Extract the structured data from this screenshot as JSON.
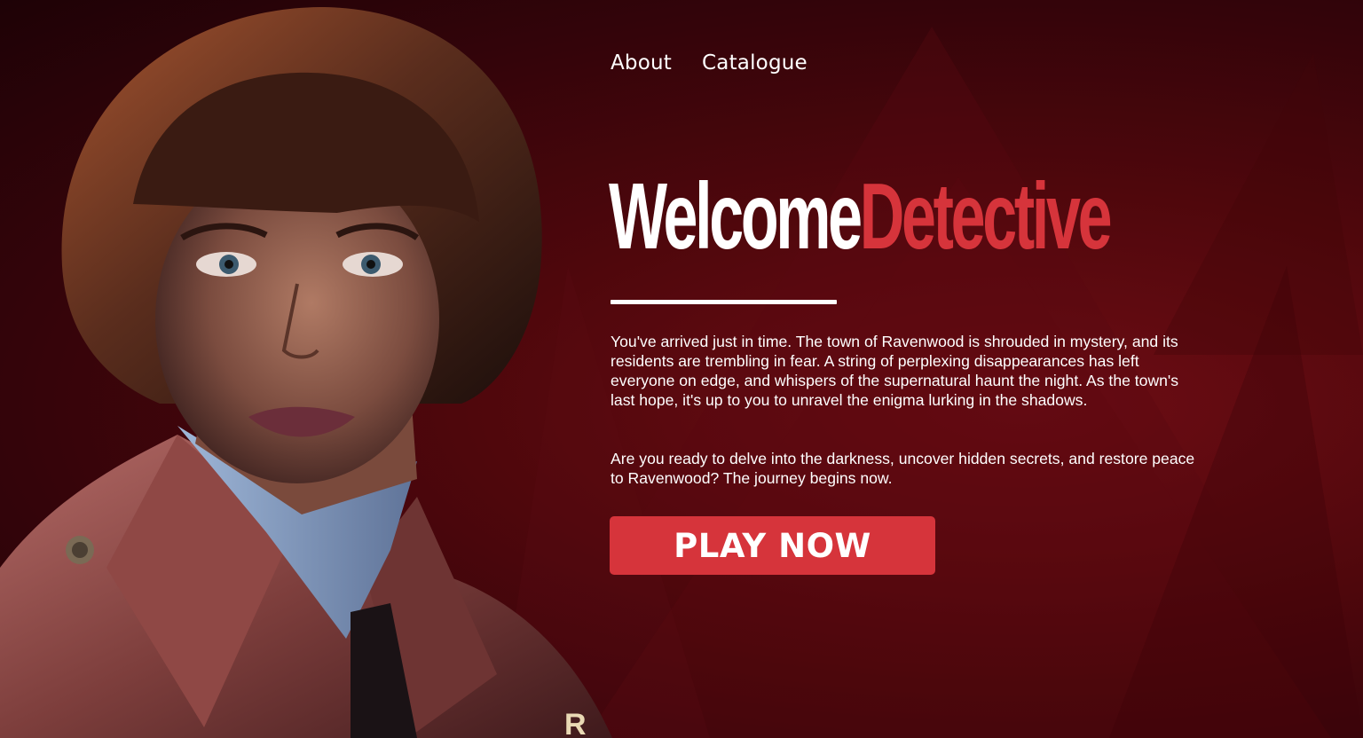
{
  "nav": {
    "items": [
      {
        "label": "About"
      },
      {
        "label": "Catalogue"
      }
    ]
  },
  "hero": {
    "title_part1": "Welcome",
    "title_part2": "Detective",
    "paragraph1": "You've arrived just in time. The town of Ravenwood is shrouded in mystery, and its residents are trembling in fear. A string of perplexing disappearances has left everyone on edge, and whispers of the supernatural haunt the night. As the town's last hope, it's up to you to unravel the enigma lurking in the shadows.",
    "paragraph2": "Are you ready to delve into the darkness, uncover hidden secrets, and restore peace to Ravenwood? The journey begins now.",
    "cta_label": "PLAY NOW"
  },
  "portrait": {
    "subject": "woman detective with bob haircut in a trench coat",
    "coat_text": "R"
  },
  "colors": {
    "background": "#4f070c",
    "accent_red": "#d6343b",
    "text": "#ffffff"
  }
}
